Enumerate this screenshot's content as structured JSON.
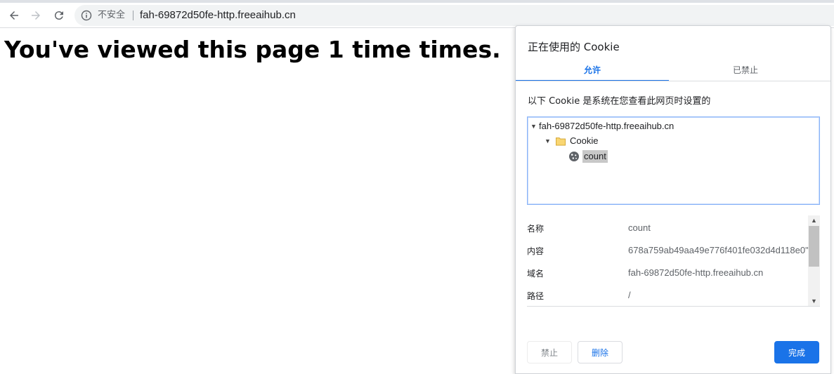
{
  "browser": {
    "security_label": "不安全",
    "url": "fah-69872d50fe-http.freeaihub.cn"
  },
  "page": {
    "heading": "You've viewed this page 1 time times."
  },
  "cookie_dialog": {
    "title": "正在使用的 Cookie",
    "tabs": [
      {
        "label": "允许",
        "active": true
      },
      {
        "label": "已禁止",
        "active": false
      }
    ],
    "description": "以下 Cookie 是系统在您查看此网页时设置的",
    "tree": {
      "site": "fah-69872d50fe-http.freeaihub.cn",
      "folder": "Cookie",
      "cookie": "count"
    },
    "details": [
      {
        "label": "名称",
        "value": "count"
      },
      {
        "label": "内容",
        "value": "678a759ab49aa49e776f401fe032d4d118e0\""
      },
      {
        "label": "域名",
        "value": "fah-69872d50fe-http.freeaihub.cn"
      },
      {
        "label": "路径",
        "value": "/"
      }
    ],
    "buttons": {
      "block": "禁止",
      "delete": "删除",
      "done": "完成"
    }
  },
  "colors": {
    "accent": "#1a73e8",
    "selection": "#c8c8c8"
  }
}
